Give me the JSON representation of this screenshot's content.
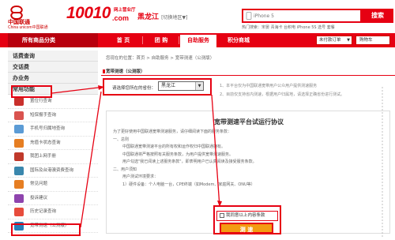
{
  "header": {
    "brand_cn": "中国联通",
    "brand_en": "China unicom中国联通",
    "brand_num": "10010",
    "brand_suffix": ".com",
    "slogan": "网上营业厅",
    "region": "黑龙江",
    "region_switch": "[切换地区▼]",
    "search_placeholder": "iPhone 5",
    "search_button": "搜索",
    "hot_searches": "热门搜索：宋晏  青海卡  台积电 iPhone 5S  选号  套餐"
  },
  "nav": {
    "category_label": "所有商品分类",
    "items": [
      {
        "label": "首  页"
      },
      {
        "label": "团  购"
      },
      {
        "label": "自助服务"
      },
      {
        "label": "积分商城"
      }
    ],
    "order_select": "未付款订单",
    "cart": "购物车"
  },
  "sidebar": {
    "top_items": [
      "话费查询",
      "交话费",
      "办业务"
    ],
    "common_heading": "常用功能",
    "items": [
      {
        "label": "置位行查询",
        "color": "#c9302c"
      },
      {
        "label": "短保报手查询",
        "color": "#d9534f"
      },
      {
        "label": "手机号归属地查询",
        "color": "#5b9bd5"
      },
      {
        "label": "充值卡状态查询",
        "color": "#e67e22"
      },
      {
        "label": "我团上网手册",
        "color": "#c0392b"
      },
      {
        "label": "国际及台港澳资费查询",
        "color": "#3a87ad"
      },
      {
        "label": "常见问题",
        "color": "#e67e22"
      },
      {
        "label": "投诉建议",
        "color": "#8e44ad"
      },
      {
        "label": "历史记录查询",
        "color": "#e74c3c"
      },
      {
        "label": "宽带测速（公测版）",
        "color": "#2980b9"
      }
    ]
  },
  "main": {
    "breadcrumb": "您现在的位置：首页 > 自助服务 > 宽带测速（公测版）",
    "section_title": "宽带测速（公测版）",
    "province_label": "请选择您所在的省份：",
    "province_value": "黑龙江",
    "notes": [
      "1、本平台仅为中国联通宽带用户公众用户提供测速服务",
      "2、目前仅支持省内测速，根据用户归属地，请选择正确省份进行测试。"
    ],
    "agreement": {
      "title": "宽带测速平台试运行协议",
      "lines": [
        {
          "text": "为了更好使用中国联通宽带测速服务，请仔细阅读下面的服务条款：",
          "indent": false
        },
        {
          "text": "一、总则",
          "indent": false
        },
        {
          "text": "中国联通宽带测速平台的所有权和运作权归中国联通拥有。",
          "indent": true
        },
        {
          "text": "中国联通将严格按照有关服务条款，为用户提供宽带测速服务。",
          "indent": true
        },
        {
          "text": "用户勾选\"我已阅读上述服务条款\"，即表明用户已认真阅读及接受服务条款。",
          "indent": true
        },
        {
          "text": "二、用户须知",
          "indent": false
        },
        {
          "text": "用户测试环境要求：",
          "indent": true
        },
        {
          "text": "1）硬件设备：个人电脑一台，CPE终端（如Modem、家庭网关、ONU等）",
          "indent": true
        }
      ],
      "checkbox_label": "我同意以上内容条款",
      "submit_label": "测  速"
    }
  },
  "colors": {
    "brand_red": "#e60012",
    "submit_orange": "#f39c12"
  }
}
